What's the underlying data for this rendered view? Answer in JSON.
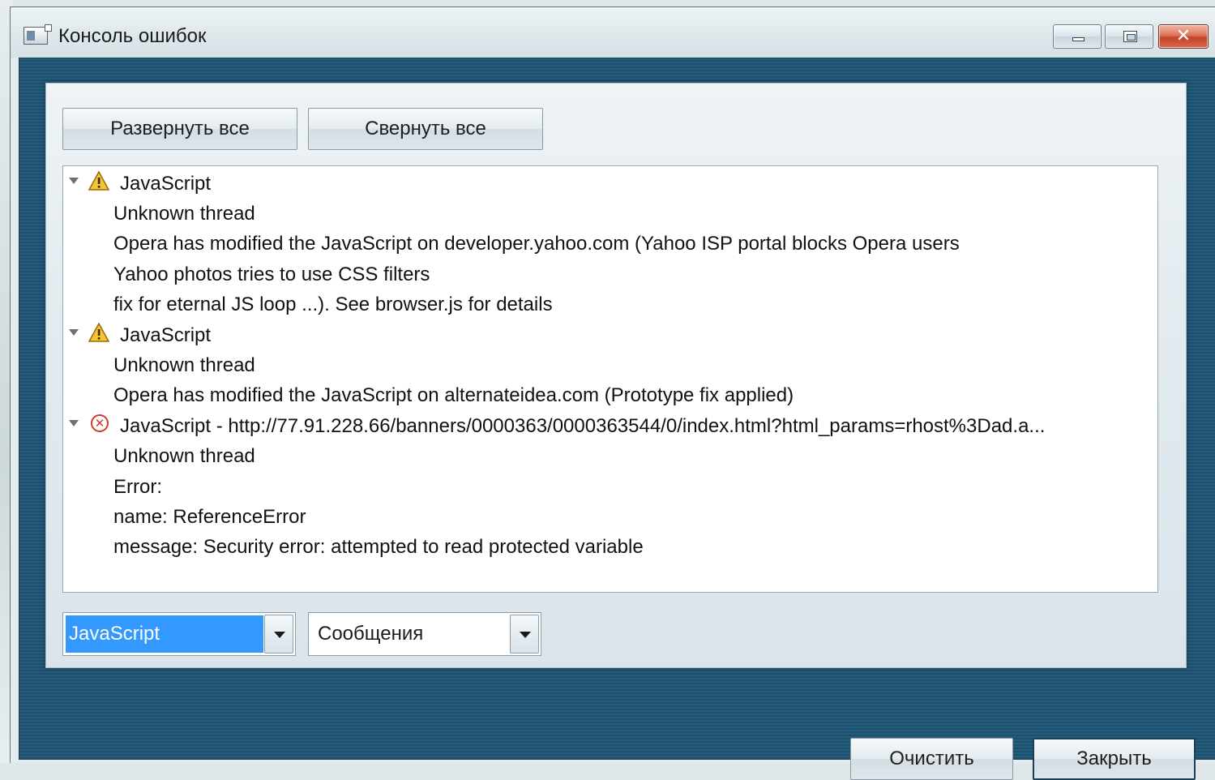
{
  "window": {
    "title": "Консоль ошибок",
    "accent": "#255c7c",
    "close_color": "#c6412a"
  },
  "toolbar": {
    "expand_all": "Развернуть все",
    "collapse_all": "Свернуть все"
  },
  "log": {
    "entries": [
      {
        "severity": "warning",
        "icon": "warning-icon",
        "title": "JavaScript",
        "lines": [
          "Unknown thread",
          "Opera has modified the JavaScript on developer.yahoo.com (Yahoo ISP portal blocks Opera users",
          "Yahoo photos tries to use CSS filters",
          "fix for eternal JS loop ...). See browser.js for details"
        ]
      },
      {
        "severity": "warning",
        "icon": "warning-icon",
        "title": "JavaScript",
        "lines": [
          "Unknown thread",
          "Opera has modified the JavaScript on alternateidea.com (Prototype fix applied)"
        ]
      },
      {
        "severity": "error",
        "icon": "error-icon",
        "title": "JavaScript - http://77.91.228.66/banners/0000363/0000363544/0/index.html?html_params=rhost%3Dad.a...",
        "lines": [
          "Unknown thread",
          "Error:",
          "name: ReferenceError",
          "message: Security error: attempted to read protected variable"
        ]
      }
    ]
  },
  "filters": {
    "source_selected": "JavaScript",
    "level_selected": "Сообщения",
    "selection_color": "#3399ff"
  },
  "footer": {
    "clear": "Очистить",
    "close": "Закрыть"
  }
}
